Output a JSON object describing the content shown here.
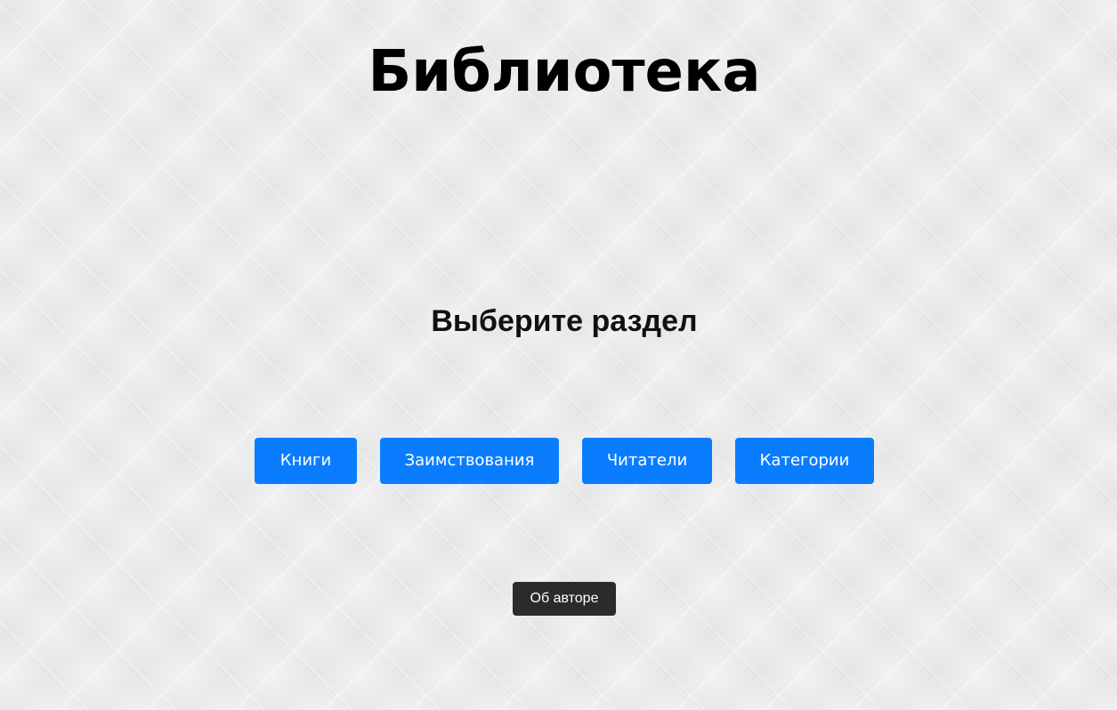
{
  "header": {
    "title": "Библиотека"
  },
  "main": {
    "prompt": "Выберите раздел",
    "sections": [
      {
        "label": "Книги"
      },
      {
        "label": "Заимствования"
      },
      {
        "label": "Читатели"
      },
      {
        "label": "Категории"
      }
    ]
  },
  "footer": {
    "about_label": "Об авторе"
  },
  "colors": {
    "primary": "#0a7dff",
    "dark_button": "#2b2b2b",
    "background": "#ebebeb"
  }
}
